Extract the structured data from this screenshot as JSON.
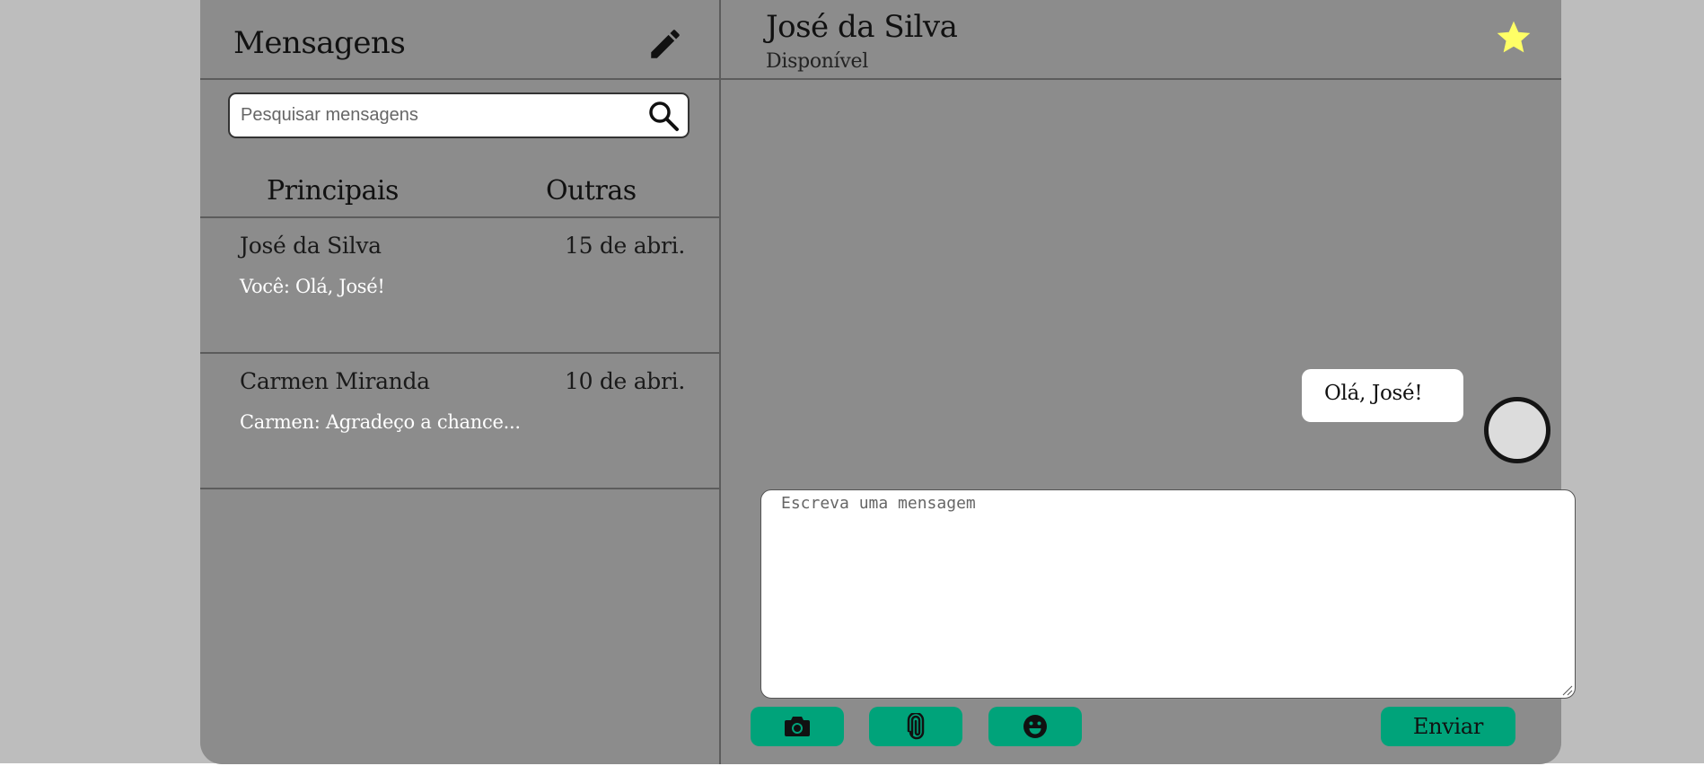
{
  "sidebar": {
    "title": "Mensagens",
    "search_placeholder": "Pesquisar mensagens",
    "tabs": [
      {
        "label": "Principais"
      },
      {
        "label": "Outras"
      }
    ],
    "conversations": [
      {
        "name": "José da Silva",
        "date": "15 de abri.",
        "preview": "Você: Olá, José!"
      },
      {
        "name": "Carmen Miranda",
        "date": "10 de abri.",
        "preview": "Carmen: Agradeço a chance..."
      }
    ]
  },
  "chat": {
    "contact_name": "José da Silva",
    "contact_status": "Disponível",
    "messages": [
      {
        "text": "Olá, José!"
      }
    ],
    "composer_placeholder": "Escreva uma mensagem",
    "send_label": "Enviar"
  },
  "icons": {
    "edit": "pencil-icon",
    "search": "search-icon",
    "favorite": "star-icon",
    "camera": "camera-icon",
    "attach": "paperclip-icon",
    "emoji": "smiley-icon"
  },
  "colors": {
    "page_bg": "#bdbdbd",
    "panel_bg": "#8c8c8c",
    "accent": "#00a37a",
    "star": "#ffff66"
  }
}
